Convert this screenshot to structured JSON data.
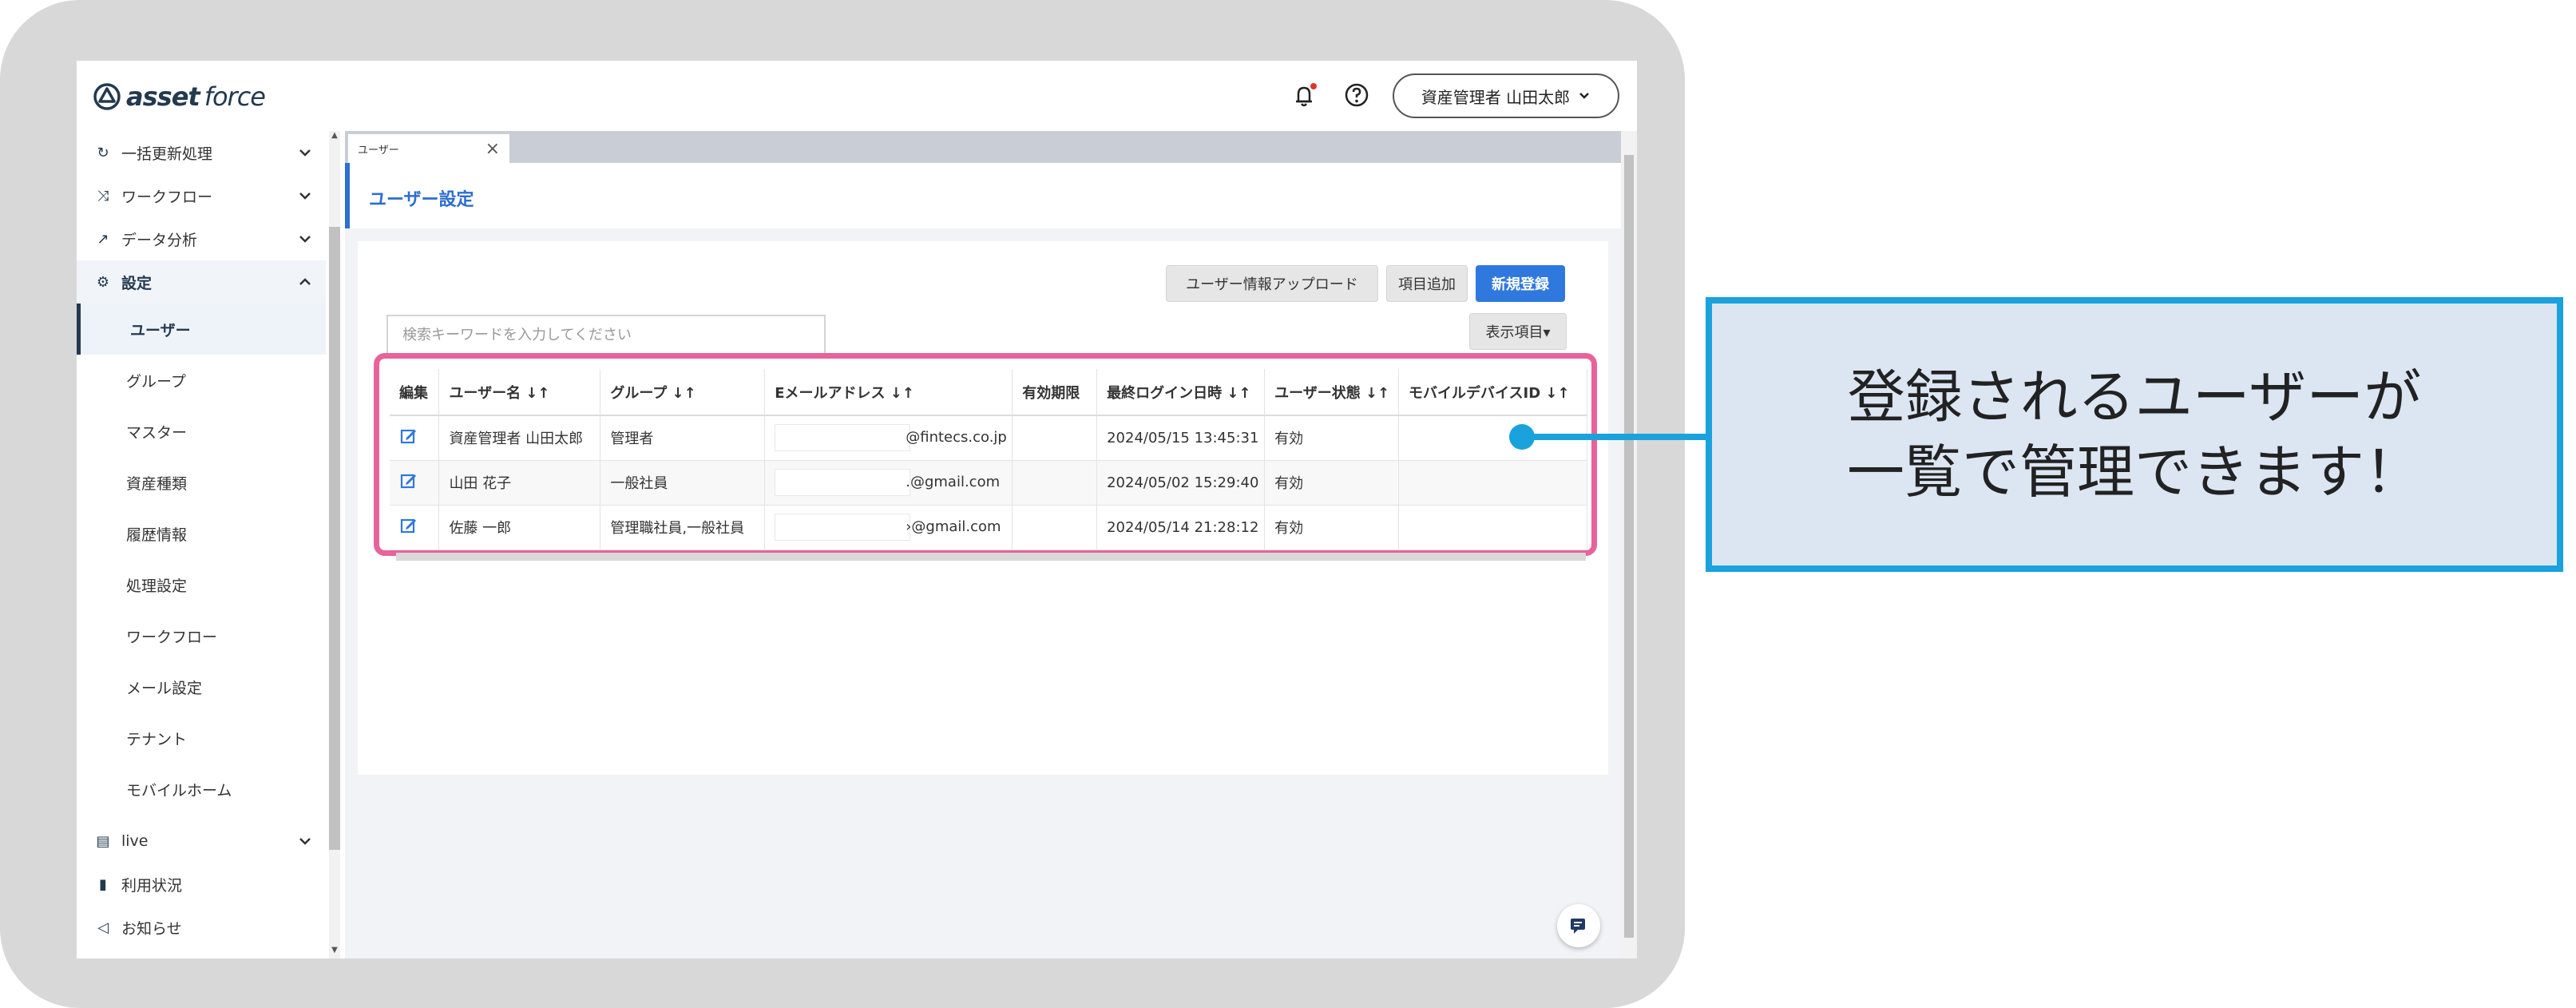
{
  "header": {
    "logo_bold": "asset",
    "logo_light": "force",
    "user_menu": "資産管理者 山田太郎"
  },
  "sidebar": {
    "groups": [
      {
        "label": "一括更新処理",
        "icon": "refresh-icon"
      },
      {
        "label": "ワークフロー",
        "icon": "workflow-icon"
      },
      {
        "label": "データ分析",
        "icon": "analytics-icon"
      },
      {
        "label": "設定",
        "icon": "gear-icon"
      }
    ],
    "settings_items": [
      "ユーザー",
      "グループ",
      "マスター",
      "資産種類",
      "履歴情報",
      "処理設定",
      "ワークフロー",
      "メール設定",
      "テナント",
      "モバイルホーム"
    ],
    "bottom_items": [
      {
        "label": "live",
        "icon": "chat-icon"
      },
      {
        "label": "利用状況",
        "icon": "bar-chart-icon"
      },
      {
        "label": "お知らせ",
        "icon": "megaphone-icon"
      }
    ]
  },
  "tab": {
    "label": "ユーザー"
  },
  "page": {
    "title": "ユーザー設定",
    "buttons": {
      "upload": "ユーザー情報アップロード",
      "add_field": "項目追加",
      "new": "新規登録",
      "display": "表示項目▾"
    },
    "search_placeholder": "検索キーワードを入力してください"
  },
  "table": {
    "headers": [
      "編集",
      "ユーザー名 ↓↑",
      "グループ ↓↑",
      "Eメールアドレス ↓↑",
      "有効期限",
      "最終ログイン日時 ↓↑",
      "ユーザー状態 ↓↑",
      "モバイルデバイスID ↓↑"
    ],
    "rows": [
      {
        "name": "資産管理者 山田太郎",
        "group": "管理者",
        "email": "@fintecs.co.jp",
        "expiry": "",
        "last_login": "2024/05/15 13:45:31",
        "status": "有効",
        "device": ""
      },
      {
        "name": "山田 花子",
        "group": "一般社員",
        "email": ".@gmail.com",
        "expiry": "",
        "last_login": "2024/05/02 15:29:40",
        "status": "有効",
        "device": ""
      },
      {
        "name": "佐藤 一郎",
        "group": "管理職社員,一般社員",
        "email": "›@gmail.com",
        "expiry": "",
        "last_login": "2024/05/14 21:28:12",
        "status": "有効",
        "device": ""
      }
    ]
  },
  "callout": {
    "line1": "登録されるユーザーが",
    "line2": "一覧で管理できます！"
  },
  "colors": {
    "accent": "#2f78de",
    "highlight": "#e8629c",
    "callout_border": "#1aa2dc",
    "callout_bg": "#dce6f2"
  }
}
